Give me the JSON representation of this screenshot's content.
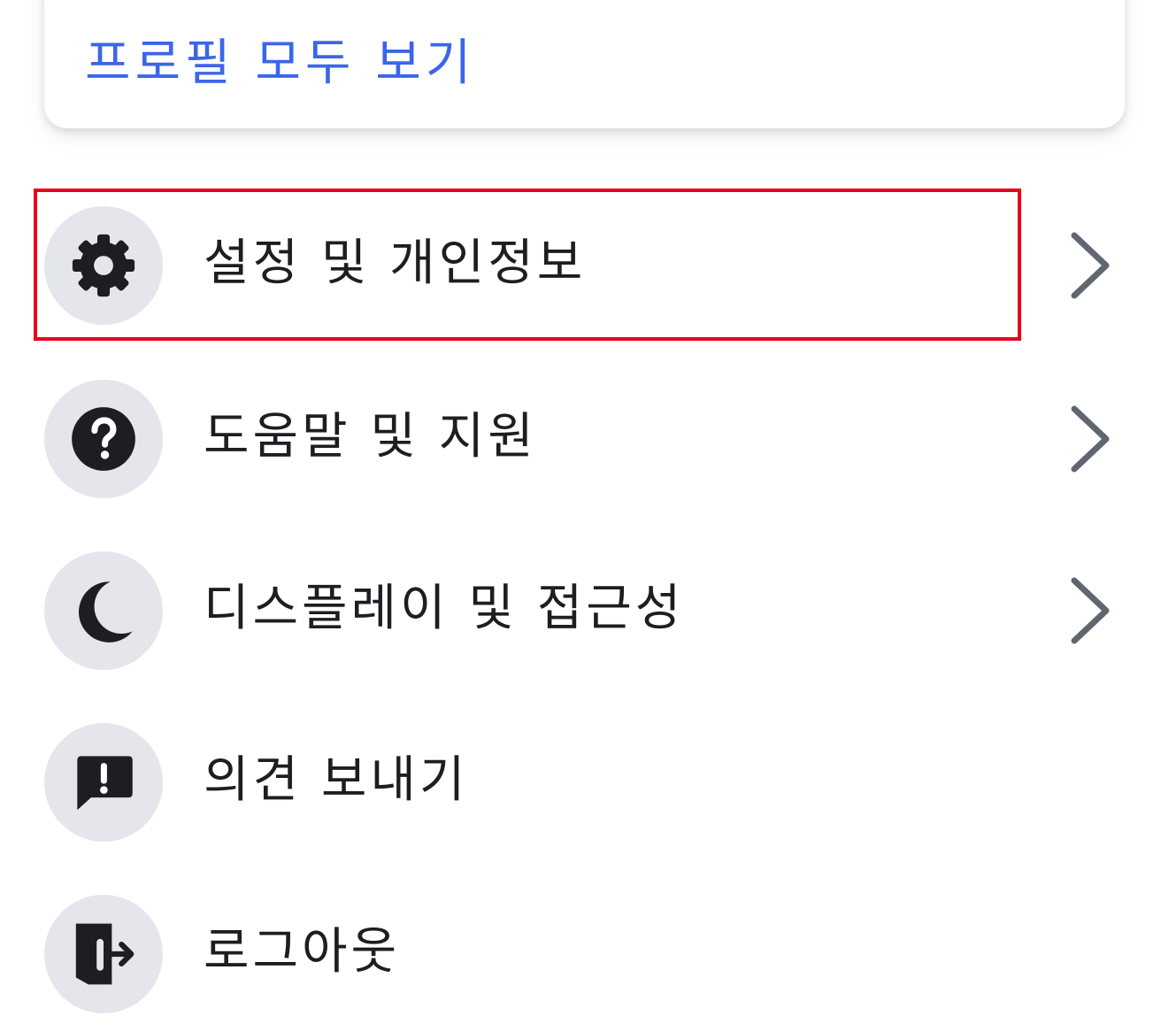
{
  "profile": {
    "see_all_label": "프로필 모두 보기"
  },
  "menu": {
    "items": [
      {
        "id": "settings",
        "icon": "gear-icon",
        "label": "설정 및 개인정보",
        "has_chevron": true,
        "highlighted": true
      },
      {
        "id": "help",
        "icon": "question-icon",
        "label": "도움말 및 지원",
        "has_chevron": true
      },
      {
        "id": "display",
        "icon": "moon-icon",
        "label": "디스플레이 및 접근성",
        "has_chevron": true
      },
      {
        "id": "feedback",
        "icon": "feedback-icon",
        "label": "의견 보내기",
        "has_chevron": false
      },
      {
        "id": "logout",
        "icon": "logout-icon",
        "label": "로그아웃",
        "has_chevron": false
      }
    ]
  },
  "colors": {
    "link": "#3b66e8",
    "text": "#1c1e21",
    "icon_bg": "#e5e6eb",
    "chevron": "#606770",
    "highlight": "#e8001c"
  }
}
